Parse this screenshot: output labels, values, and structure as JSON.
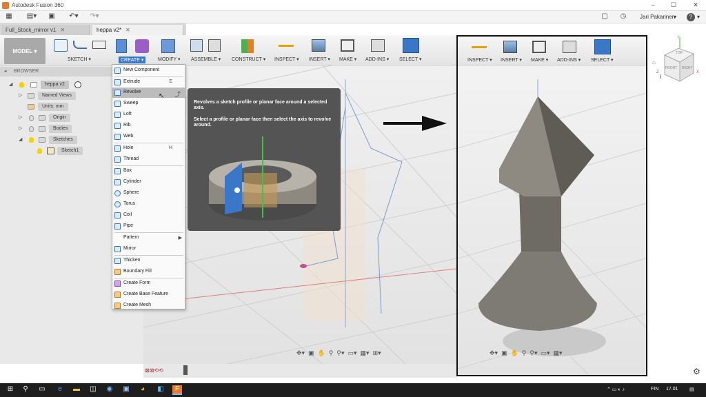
{
  "window": {
    "title": "Autodesk Fusion 360",
    "user": "Jari Pakarinen",
    "help": "?"
  },
  "tabs": [
    {
      "label": "Full_Stock_mirror v1",
      "active": false
    },
    {
      "label": "heppa v2*",
      "active": true
    }
  ],
  "toolbar": {
    "workspace": "MODEL",
    "groups": [
      "SKETCH",
      "CREATE",
      "MODIFY",
      "ASSEMBLE",
      "CONSTRUCT",
      "INSPECT",
      "INSERT",
      "MAKE",
      "ADD-INS",
      "SELECT"
    ]
  },
  "right_toolbar": {
    "groups": [
      "INSPECT",
      "INSERT",
      "MAKE",
      "ADD-INS",
      "SELECT"
    ]
  },
  "browser": {
    "header": "BROWSER",
    "items": [
      {
        "label": "heppa v2"
      },
      {
        "label": "Named Views"
      },
      {
        "label": "Units: mm"
      },
      {
        "label": "Origin"
      },
      {
        "label": "Bodies"
      },
      {
        "label": "Sketches"
      },
      {
        "label": "Sketch1"
      }
    ]
  },
  "create_menu": {
    "items": [
      {
        "label": "New Component",
        "shortcut": ""
      },
      {
        "label": "Extrude",
        "shortcut": "E"
      },
      {
        "label": "Revolve",
        "shortcut": "",
        "highlighted": true
      },
      {
        "label": "Sweep",
        "shortcut": ""
      },
      {
        "label": "Loft",
        "shortcut": ""
      },
      {
        "label": "Rib",
        "shortcut": ""
      },
      {
        "label": "Web",
        "shortcut": ""
      },
      {
        "label": "Hole",
        "shortcut": "H"
      },
      {
        "label": "Thread",
        "shortcut": ""
      },
      {
        "label": "Box",
        "shortcut": ""
      },
      {
        "label": "Cylinder",
        "shortcut": ""
      },
      {
        "label": "Sphere",
        "shortcut": ""
      },
      {
        "label": "Torus",
        "shortcut": ""
      },
      {
        "label": "Coil",
        "shortcut": ""
      },
      {
        "label": "Pipe",
        "shortcut": ""
      },
      {
        "label": "Pattern",
        "shortcut": ""
      },
      {
        "label": "Mirror",
        "shortcut": ""
      },
      {
        "label": "Thicken",
        "shortcut": ""
      },
      {
        "label": "Boundary Fill",
        "shortcut": ""
      },
      {
        "label": "Create Form",
        "shortcut": ""
      },
      {
        "label": "Create Base Feature",
        "shortcut": ""
      },
      {
        "label": "Create Mesh",
        "shortcut": ""
      }
    ]
  },
  "tooltip": {
    "line1": "Revolves a sketch profile or planar face around a selected axis.",
    "line2": "Select a profile or planar face then select the axis to revolve around."
  },
  "viewcube": {
    "top": "TOP",
    "front": "FRONT",
    "right": "RIGHT",
    "x": "X",
    "y": "Y",
    "z": "Z"
  },
  "taskbar": {
    "lang": "FIN",
    "time": "17.01"
  },
  "colors": {
    "accent": "#3a78c7",
    "menu_highlight": "#bcbcbc",
    "tooltip_bg": "#545454"
  }
}
